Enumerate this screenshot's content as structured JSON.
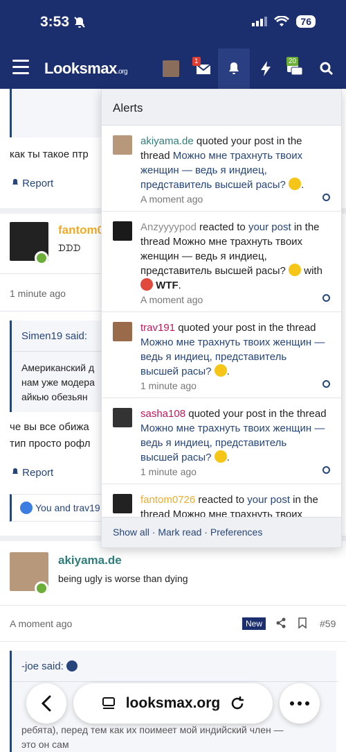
{
  "status_bar": {
    "time": "3:53",
    "battery": "76"
  },
  "navbar": {
    "logo": "Looksmax",
    "logo_suffix": ".org",
    "conversations_badge": "1",
    "alerts_badge": "20"
  },
  "thread": {
    "post1_text": "как ты такое птр",
    "report_label": "Report",
    "post2_username": "fantom0",
    "post2_sig": "ᗪᗪᗪ",
    "post2_time": "1 minute ago",
    "post2_quote_author": "Simen19 said:",
    "post2_quote_line1": "Американский д",
    "post2_quote_line2": "нам уже модера",
    "post2_quote_line3": "айкью обезьян",
    "post2_text_line1": "че вы все обижа",
    "post2_text_line2": "тип просто рофл",
    "post2_report": "Report",
    "post2_reactions": "You and trav19",
    "post3_username": "akiyama.de",
    "post3_sig": "being ugly is worse than dying",
    "post3_time": "A moment ago",
    "post3_new": "New",
    "post3_number": "#59",
    "post3_quote_author": "-joe said:",
    "post3_quote_line1": "ребята), перед тем как их поимеет мой индийский член —",
    "post3_quote_line2": "это он сам"
  },
  "alerts_menu": {
    "title": "Alerts",
    "items": [
      {
        "user": "akiyama.de",
        "action": "quoted your post in the thread",
        "thread": "Можно мне трахнуть твоих женщин — ведь я индиец, представитель высшей расы?",
        "time": "A moment ago"
      },
      {
        "user": "Anzyyyypod",
        "action": "reacted to",
        "post_link": "your post",
        "action2": "in the thread Можно мне трахнуть твоих женщин — ведь я индиец, представитель высшей расы?",
        "with": "with",
        "reaction": "WTF",
        "time": "A moment ago"
      },
      {
        "user": "trav191",
        "action": "quoted your post in the thread",
        "thread": "Можно мне трахнуть твоих женщин — ведь я индиец, представитель высшей расы?",
        "time": "1 minute ago"
      },
      {
        "user": "sasha108",
        "action": "quoted your post in the thread",
        "thread": "Можно мне трахнуть твоих женщин — ведь я индиец, представитель высшей расы?",
        "time": "1 minute ago"
      },
      {
        "user": "fantom0726",
        "action": "reacted to",
        "post_link": "your post",
        "action2": "in the thread Можно мне трахнуть твоих",
        "time": ""
      }
    ],
    "footer_show_all": "Show all",
    "footer_mark_read": "Mark read",
    "footer_preferences": "Preferences",
    "footer_sep": "·"
  },
  "browser": {
    "url": "looksmax.org"
  },
  "colors": {
    "nav": "#1b2e6e",
    "link": "#26457a",
    "orange_user": "#f1ab2b",
    "teal_user": "#2f7d7a",
    "pink_user": "#c2185b"
  }
}
